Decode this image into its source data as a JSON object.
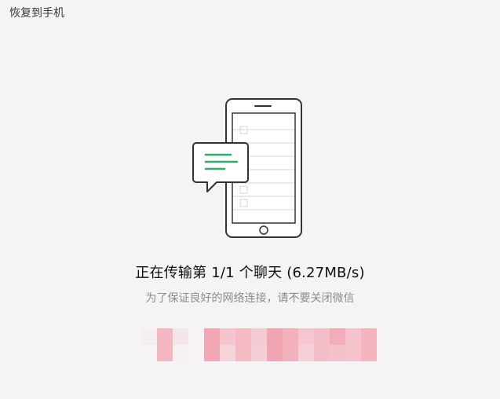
{
  "window": {
    "title": "恢复到手机"
  },
  "transfer": {
    "status_text": "正在传输第 1/1 个聊天 (6.27MB/s)",
    "hint_text": "为了保证良好的网络连接，请不要关闭微信"
  },
  "icons": {
    "illustration": "phone-with-chat-bubble-icon"
  },
  "colors": {
    "background": "#f4f4f6",
    "accent_green": "#2aae67",
    "text_primary": "#111111",
    "text_secondary": "#8c8c8c"
  }
}
